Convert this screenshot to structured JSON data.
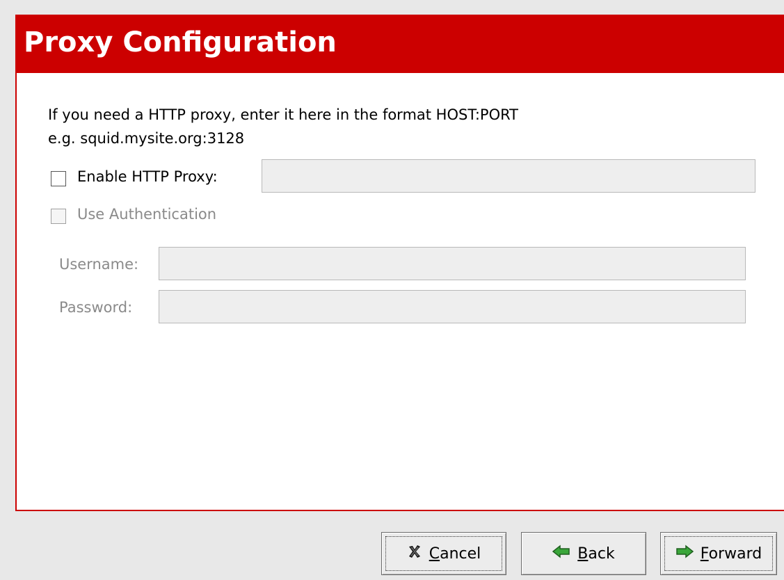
{
  "header": {
    "title": "Proxy Configuration"
  },
  "instructions": {
    "line1": "If you need a HTTP proxy, enter it here in the format HOST:PORT",
    "line2": "e.g. squid.mysite.org:3128"
  },
  "proxy": {
    "enable_label": "Enable HTTP Proxy:",
    "enabled": false,
    "value": ""
  },
  "auth": {
    "use_label": "Use Authentication",
    "enabled": false,
    "username_label": "Username:",
    "username_value": "",
    "password_label": "Password:",
    "password_value": ""
  },
  "buttons": {
    "cancel": {
      "mnemonic": "C",
      "rest": "ancel",
      "icon": "x-cancel-icon"
    },
    "back": {
      "mnemonic": "B",
      "rest": "ack",
      "icon": "arrow-left-icon"
    },
    "forward": {
      "mnemonic": "F",
      "rest": "orward",
      "icon": "arrow-right-icon"
    }
  },
  "colors": {
    "header": "#cc0000",
    "header_text": "#ffffff",
    "arrow_green": "#3aa63a"
  }
}
